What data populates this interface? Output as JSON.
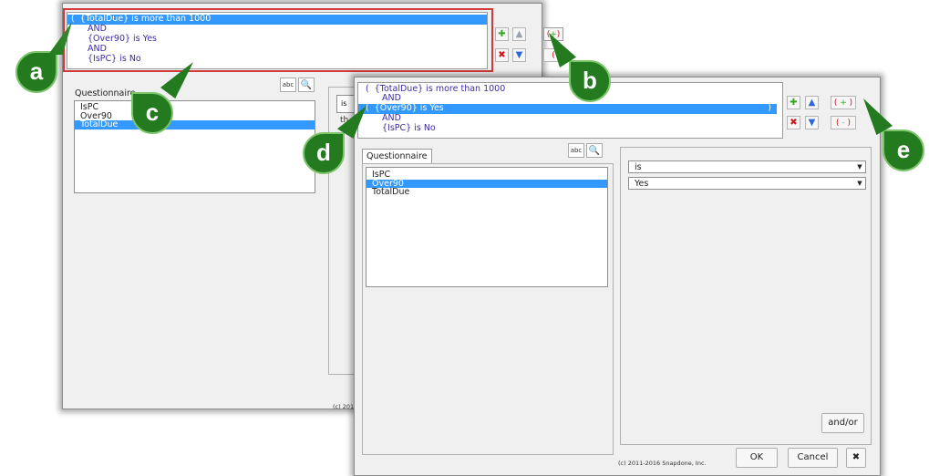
{
  "conditions": [
    {
      "prefix": "(",
      "text": "{TotalDue} is more than 1000",
      "suffix": ""
    },
    {
      "prefix": "",
      "text": "AND",
      "suffix": ""
    },
    {
      "prefix": "",
      "text": "{Over90} is Yes",
      "suffix": ""
    },
    {
      "prefix": "",
      "text": "AND",
      "suffix": ""
    },
    {
      "prefix": "",
      "text": "{IsPC} is No",
      "suffix": ""
    }
  ],
  "conditions_front": [
    {
      "prefix": "(",
      "text": "{TotalDue} is more than 1000",
      "suffix": ""
    },
    {
      "prefix": "",
      "text": "AND",
      "suffix": ""
    },
    {
      "prefix": "(",
      "text": "{Over90} is Yes",
      "suffix": ")"
    },
    {
      "prefix": "",
      "text": "AND",
      "suffix": ""
    },
    {
      "prefix": "",
      "text": "{IsPC} is No",
      "suffix": ""
    }
  ],
  "toolbar": {
    "add_paren_label": "( + )",
    "remove_paren_label": "( - )",
    "paren_left": "(",
    "paren_right": ")",
    "add_icon": "plus-icon",
    "delete_icon": "x-icon",
    "up_icon": "up-arrow-icon",
    "down_icon": "down-arrow-icon"
  },
  "tab_label": "Questionnaire",
  "abc_label": "abc",
  "fields": [
    "IsPC",
    "Over90",
    "TotalDue"
  ],
  "back_selected_field": "TotalDue",
  "front_selected_field": "Over90",
  "back_partial": {
    "combo_text": "is",
    "frag_text": "th"
  },
  "operator": "is",
  "value": "Yes",
  "andor_label": "and/or",
  "ok_label": "OK",
  "cancel_label": "Cancel",
  "copyright": "(c) 2011-2016 Snapdone, Inc.",
  "copyright_back": "(c) 2011-",
  "callouts": {
    "a": "a",
    "b": "b",
    "c": "c",
    "d": "d",
    "e": "e"
  },
  "colors": {
    "selection": "#3399ff",
    "callout": "#237a1f",
    "highlight_border": "#d03a3a"
  }
}
